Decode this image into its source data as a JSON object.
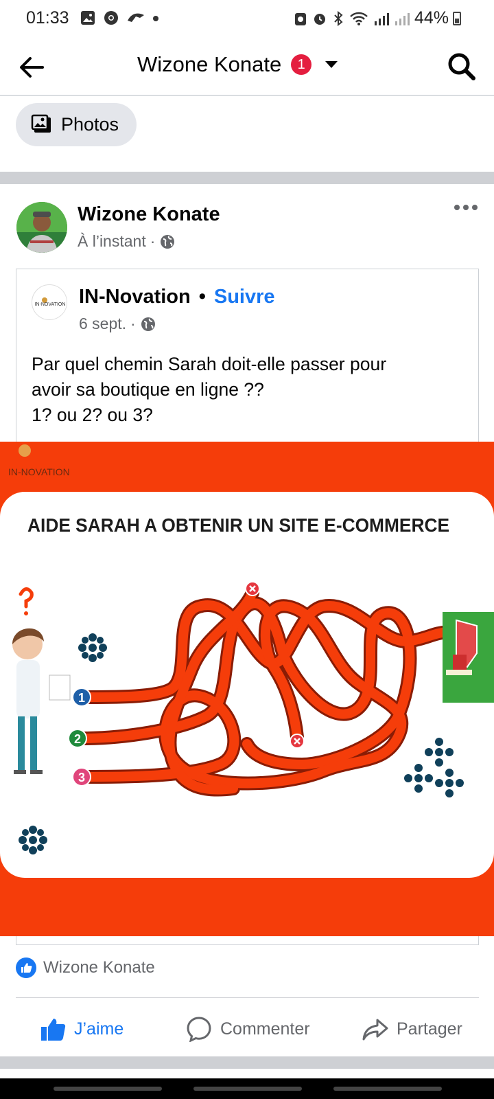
{
  "status_bar": {
    "time": "01:33",
    "battery": "44%"
  },
  "top_bar": {
    "title": "Wizone Konate",
    "badge_count": "1"
  },
  "filter_chip": {
    "label": "Photos"
  },
  "post": {
    "author": "Wizone Konate",
    "time": "À l’instant",
    "time_separator": "·",
    "shared": {
      "page_name": "IN-Novation",
      "dot": "•",
      "follow_label": "Suivre",
      "date": "6 sept.",
      "date_separator": "·",
      "avatar_logo_text": "IN-NOVATION",
      "text_lines": [
        "Par quel chemin Sarah doit-elle passer pour",
        "avoir sa boutique en ligne ??",
        "1? ou 2? ou 3?"
      ]
    },
    "image": {
      "logo_text": "IN-NOVATION",
      "headline": "AIDE SARAH  A  OBTENIR UN SITE E-COMMERCE",
      "path_numbers": [
        "1",
        "2",
        "3"
      ],
      "path_number_colors": [
        "#1e5fa8",
        "#1f8a3b",
        "#e0457b"
      ],
      "accent_color": "#f53d0a"
    },
    "reactions": {
      "names": "Wizone Konate"
    },
    "actions": {
      "like": "J’aime",
      "comment": "Commenter",
      "share": "Partager"
    }
  },
  "colors": {
    "facebook_blue": "#1877f2",
    "secondary_text": "#65676b",
    "badge_red": "#e41e3f",
    "separator_gray": "#ced0d4"
  }
}
